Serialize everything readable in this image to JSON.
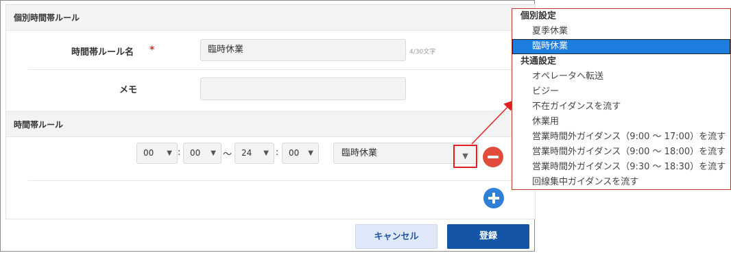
{
  "section1": {
    "title": "個別時間帯ルール"
  },
  "form": {
    "name_label": "時間帯ルール名",
    "required_mark": "*",
    "name_value": "臨時休業",
    "name_counter": "4/30文字",
    "memo_label": "メモ",
    "memo_value": ""
  },
  "section2": {
    "title": "時間帯ルール"
  },
  "time_rule": {
    "start_hour": "00",
    "start_min": "00",
    "end_hour": "24",
    "end_min": "00",
    "colon": ":",
    "tilde": "～",
    "rule_value": "臨時休業",
    "arrow_glyph": "▼"
  },
  "buttons": {
    "cancel": "キャンセル",
    "submit": "登録"
  },
  "dropdown": {
    "groups": [
      {
        "label": "個別設定",
        "items": [
          "夏季休業",
          "臨時休業"
        ]
      },
      {
        "label": "共通設定",
        "items": [
          "オペレータへ転送",
          "ビジー",
          "不在ガイダンスを流す",
          "休業用",
          "営業時間外ガイダンス（9:00 ～ 17:00）を流す",
          "営業時間外ガイダンス（9:00 ～ 18:00）を流す",
          "営業時間外ガイダンス（9:30 ～ 18:30）を流す",
          "回線集中ガイダンスを流す"
        ]
      }
    ],
    "selected": "臨時休業"
  },
  "colors": {
    "primary": "#1455a8",
    "highlight": "#1e7ee0",
    "danger": "#e24c3c",
    "add": "#2f7fd6",
    "callout": "#e02020"
  }
}
